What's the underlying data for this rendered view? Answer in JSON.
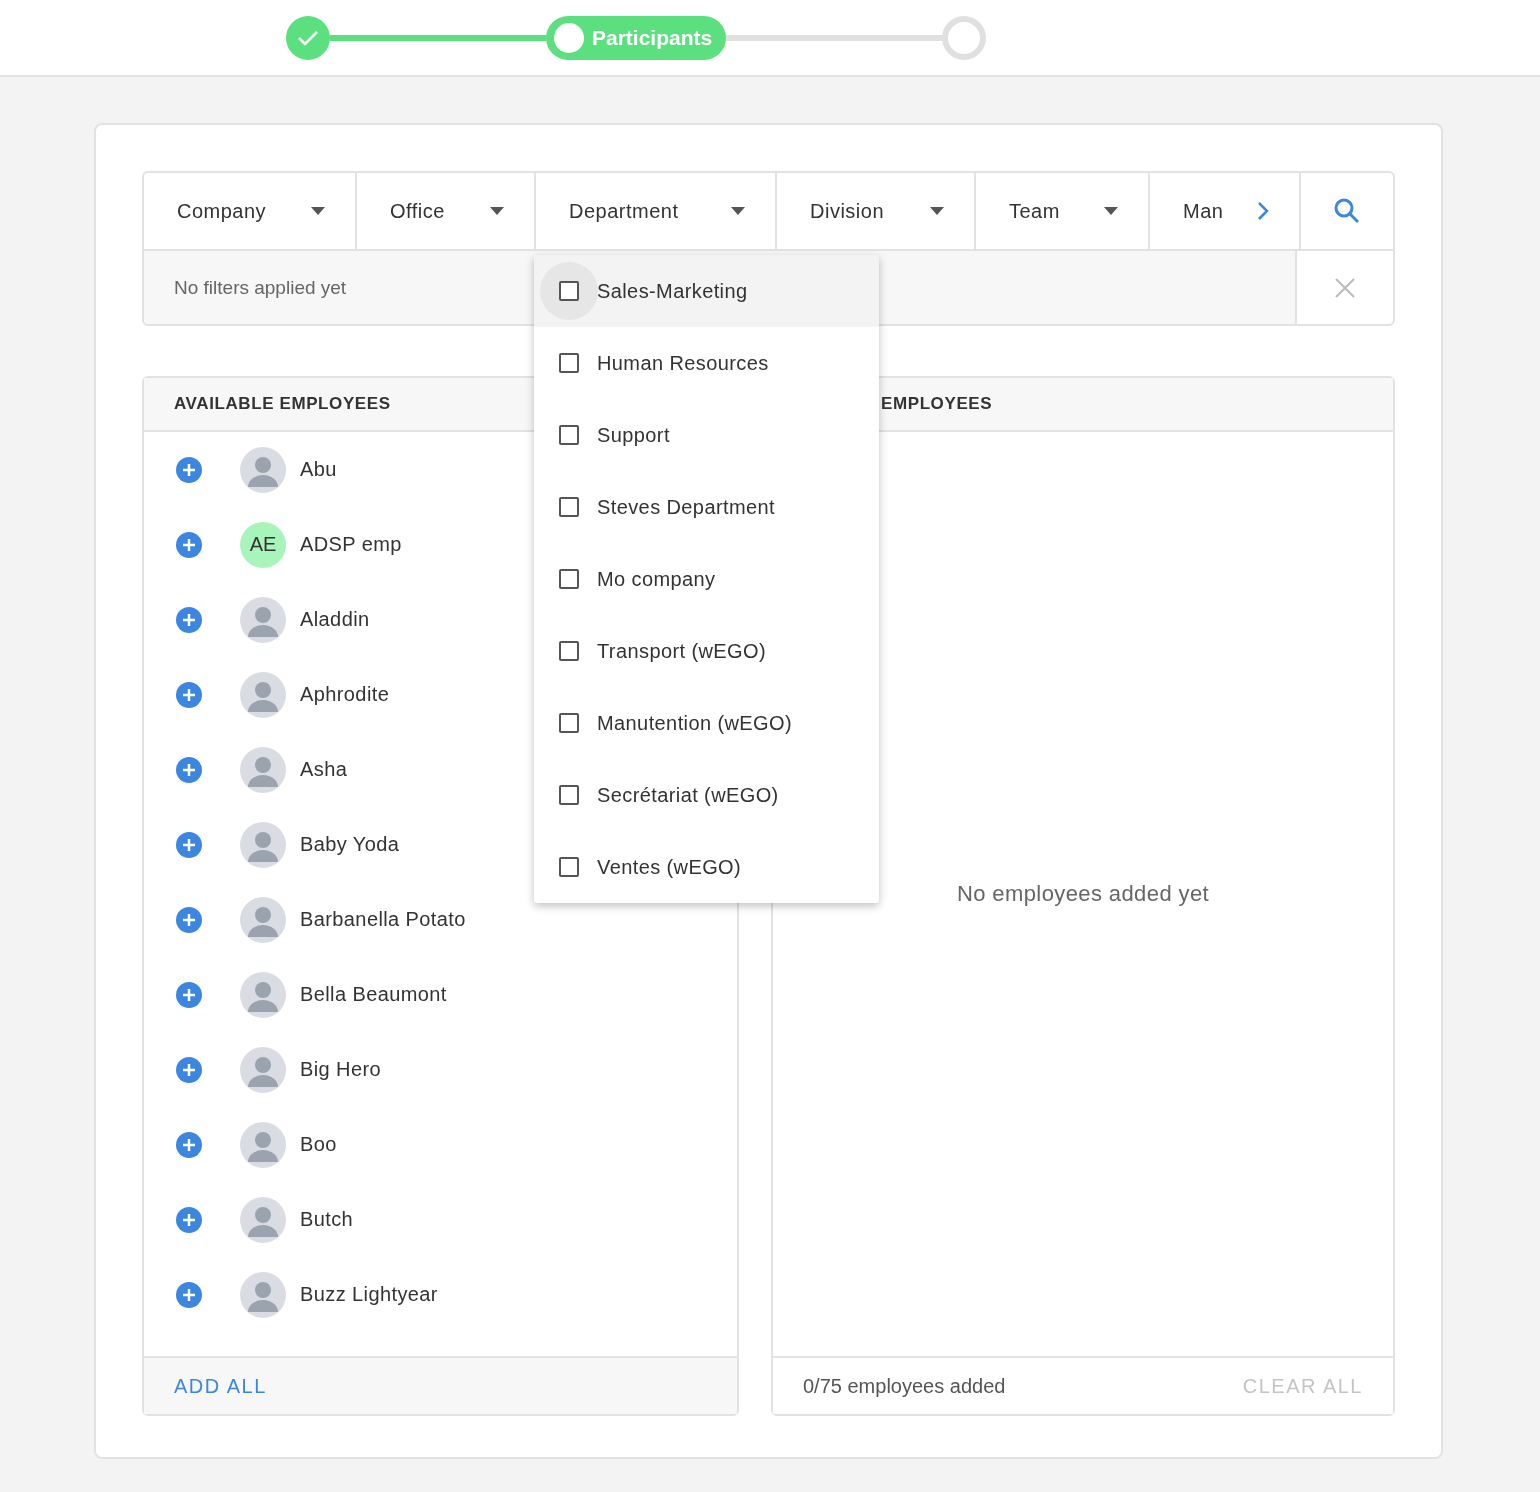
{
  "stepper": {
    "steps": [
      {
        "completed": true,
        "selected": false
      },
      {
        "completed": false,
        "selected": true,
        "label": "Participants"
      },
      {
        "completed": false,
        "selected": false
      }
    ]
  },
  "filters": {
    "columns": [
      {
        "label": "Company",
        "kind": "dropdown"
      },
      {
        "label": "Office",
        "kind": "dropdown"
      },
      {
        "label": "Department",
        "kind": "dropdown"
      },
      {
        "label": "Division",
        "kind": "dropdown"
      },
      {
        "label": "Team",
        "kind": "dropdown"
      },
      {
        "label": "Man",
        "kind": "more"
      }
    ],
    "applied_placeholder": "No filters applied yet"
  },
  "department_menu": [
    {
      "label": "Sales-Marketing",
      "checked": false,
      "selected": true
    },
    {
      "label": "Human Resources",
      "checked": false,
      "selected": false
    },
    {
      "label": "Support",
      "checked": false,
      "selected": false
    },
    {
      "label": "Steves Department",
      "checked": false,
      "selected": false
    },
    {
      "label": "Mo company",
      "checked": false,
      "selected": false
    },
    {
      "label": "Transport (wEGO)",
      "checked": false,
      "selected": false
    },
    {
      "label": "Manutention (wEGO)",
      "checked": false,
      "selected": false
    },
    {
      "label": "Secrétariat (wEGO)",
      "checked": false,
      "selected": false
    },
    {
      "label": "Ventes (wEGO)",
      "checked": false,
      "selected": false
    }
  ],
  "available": {
    "title": "AVAILABLE EMPLOYEES",
    "employees": [
      {
        "name": "Abu"
      },
      {
        "name": "ADSP emp",
        "avatar": {
          "kind": "initials",
          "text": "AE"
        }
      },
      {
        "name": "Aladdin"
      },
      {
        "name": "Aphrodite"
      },
      {
        "name": "Asha"
      },
      {
        "name": "Baby Yoda"
      },
      {
        "name": "Barbanella Potato"
      },
      {
        "name": "Bella Beaumont"
      },
      {
        "name": "Big Hero"
      },
      {
        "name": "Boo"
      },
      {
        "name": "Butch"
      },
      {
        "name": "Buzz Lightyear"
      }
    ],
    "add_all": "ADD ALL"
  },
  "selected": {
    "title": "EMPLOYEES",
    "empty_text": "No employees added yet",
    "count_text": "0/75 employees added",
    "clear_all": "CLEAR ALL"
  }
}
